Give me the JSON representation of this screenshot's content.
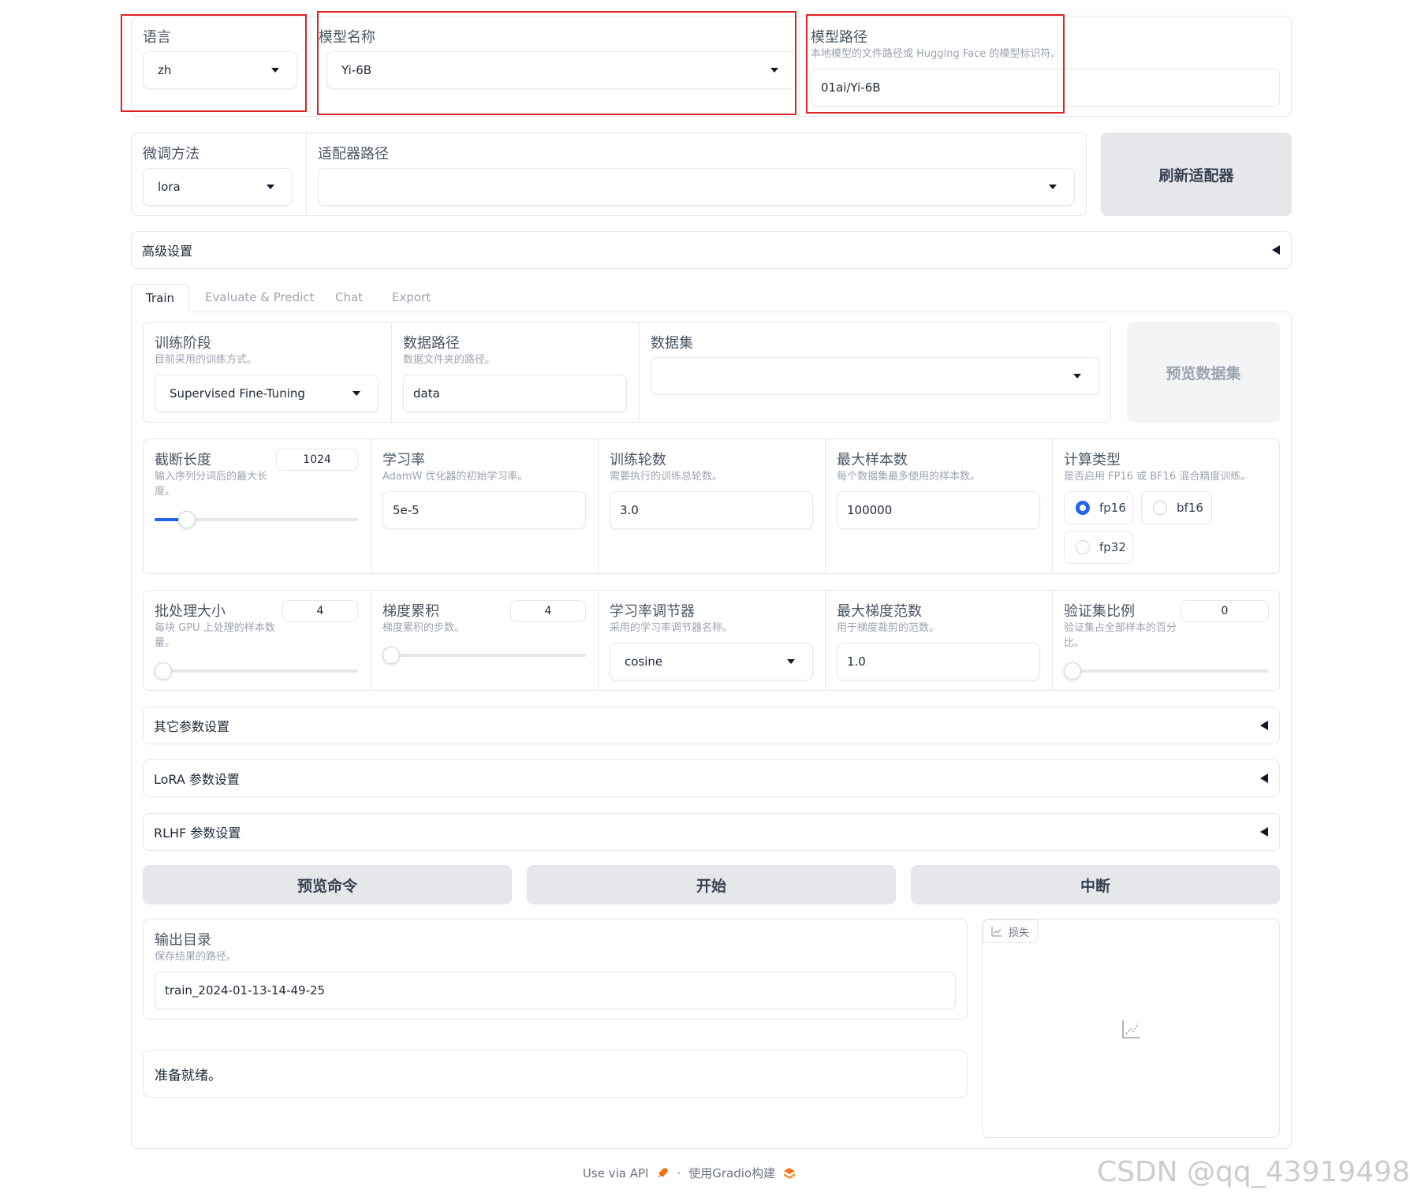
{
  "top": {
    "lang": {
      "label": "语言",
      "value": "zh"
    },
    "model_name": {
      "label": "模型名称",
      "value": "Yi-6B"
    },
    "model_path": {
      "label": "模型路径",
      "info": "本地模型的文件路径或 Hugging Face 的模型标识符。",
      "value": "01ai/Yi-6B"
    }
  },
  "finetune": {
    "method": {
      "label": "微调方法",
      "value": "lora"
    },
    "adapter": {
      "label": "适配器路径",
      "value": ""
    },
    "refresh_button": "刷新适配器"
  },
  "advanced": {
    "label": "高级设置"
  },
  "tabs": [
    "Train",
    "Evaluate & Predict",
    "Chat",
    "Export"
  ],
  "train": {
    "stage": {
      "label": "训练阶段",
      "info": "目前采用的训练方式。",
      "value": "Supervised Fine-Tuning"
    },
    "dataset_dir": {
      "label": "数据路径",
      "info": "数据文件夹的路径。",
      "value": "data"
    },
    "dataset": {
      "label": "数据集",
      "value": ""
    },
    "preview_dataset_button": "预览数据集",
    "cutoff_len": {
      "label": "截断长度",
      "info": "输入序列分词后的最大长度。",
      "value": "1024",
      "fraction": 0.16
    },
    "learning_rate": {
      "label": "学习率",
      "info": "AdamW 优化器的初始学习率。",
      "value": "5e-5"
    },
    "num_epochs": {
      "label": "训练轮数",
      "info": "需要执行的训练总轮数。",
      "value": "3.0"
    },
    "max_samples": {
      "label": "最大样本数",
      "info": "每个数据集最多使用的样本数。",
      "value": "100000"
    },
    "compute_type": {
      "label": "计算类型",
      "info": "是否启用 FP16 或 BF16 混合精度训练。",
      "options": [
        "fp16",
        "bf16",
        "fp32"
      ],
      "selected": "fp16"
    },
    "batch_size": {
      "label": "批处理大小",
      "info": "每块 GPU 上处理的样本数量。",
      "value": "4",
      "fraction": 0.02
    },
    "grad_accum": {
      "label": "梯度累积",
      "info": "梯度累积的步数。",
      "value": "4",
      "fraction": 0.02
    },
    "lr_scheduler": {
      "label": "学习率调节器",
      "info": "采用的学习率调节器名称。",
      "value": "cosine"
    },
    "max_grad_norm": {
      "label": "最大梯度范数",
      "info": "用于梯度裁剪的范数。",
      "value": "1.0"
    },
    "val_size": {
      "label": "验证集比例",
      "info": "验证集占全部样本的百分比。",
      "value": "0",
      "fraction": 0.0
    },
    "other_params": "其它参数设置",
    "lora_params": "LoRA 参数设置",
    "rlhf_params": "RLHF 参数设置",
    "preview_cmd_button": "预览命令",
    "start_button": "开始",
    "stop_button": "中断",
    "output_dir": {
      "label": "输出目录",
      "info": "保存结果的路径。",
      "value": "train_2024-01-13-14-49-25"
    },
    "status": "准备就绪。",
    "loss_label": "损失"
  },
  "footer": {
    "api": "Use via API",
    "sep": "·",
    "built": "使用Gradio构建"
  },
  "watermark": "CSDN @qq_43919498",
  "colors": {
    "accent": "#2563eb",
    "highlight": "#e02424"
  }
}
